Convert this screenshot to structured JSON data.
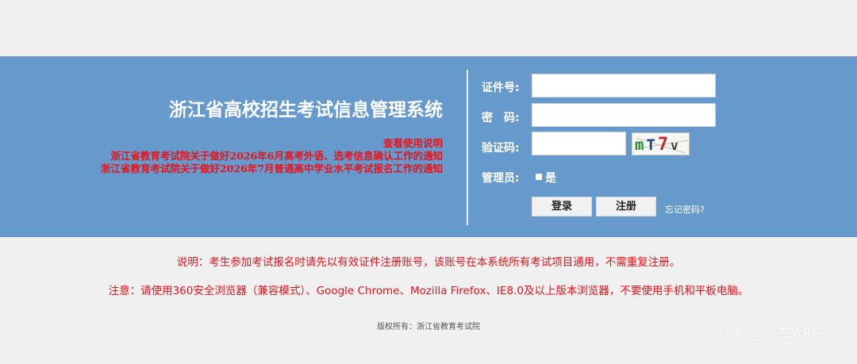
{
  "header": {
    "system_title": "浙江省高校招生考试信息管理系统",
    "notices": [
      "查看使用说明",
      "浙江省教育考试院关于做好2026年6月高考外语、选考信息确认工作的通知",
      "浙江省教育考试院关于做好2026年7月普通高中学业水平考试报名工作的通知"
    ]
  },
  "login": {
    "id_label": "证件号:",
    "id_value": "",
    "password_label": "密　码:",
    "password_value": "",
    "captcha_label": "验证码:",
    "captcha_value": "",
    "captcha_text": "mT7v",
    "admin_label": "管理员:",
    "admin_option": "是",
    "admin_checked": false,
    "login_button": "登录",
    "register_button": "注册",
    "forgot_link": "忘记密码?"
  },
  "info": {
    "note": "说明：考生参加考试报名时请先以有效证件注册账号，该账号在本系统所有考试项目通用，不需重复注册。",
    "warning": "注意：请使用360安全浏览器（兼容模式）、Google Chrome、Mozilla Firefox、IE8.0及以上版本浏览器，不要使用手机和平板电脑。"
  },
  "footer": {
    "copyright": "版权所有：浙江省教育考试院"
  },
  "watermark": "高考直通车APP",
  "colors": {
    "banner": "#6699cc",
    "page_background": "#f0f0f0",
    "notice_red": "#e8121a"
  }
}
